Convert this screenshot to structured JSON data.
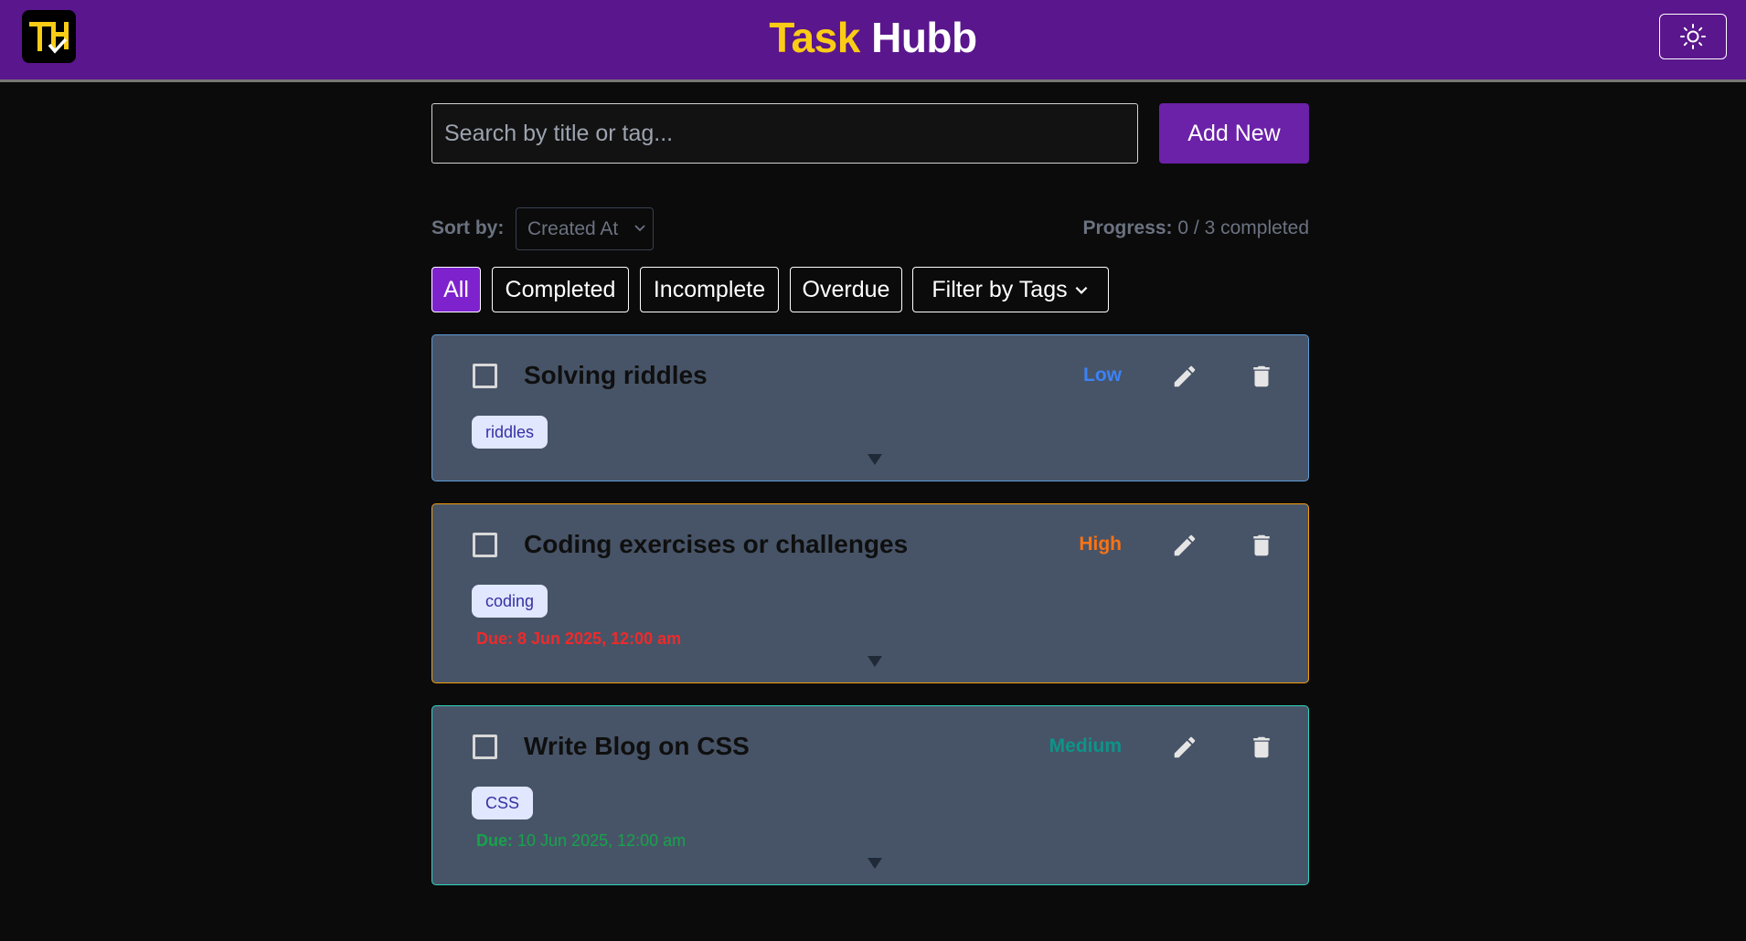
{
  "header": {
    "logo_text": "TH",
    "title_part1": "Task",
    "title_part2": "Hubb",
    "theme_icon": "sun-icon"
  },
  "toolbar": {
    "search_placeholder": "Search by title or tag...",
    "add_label": "Add New"
  },
  "sort": {
    "label": "Sort by:",
    "selected": "Created At"
  },
  "progress": {
    "label": "Progress:",
    "value": "0 / 3 completed"
  },
  "filters": [
    "All",
    "Completed",
    "Incomplete",
    "Overdue",
    "Filter by Tags"
  ],
  "tasks": [
    {
      "title": "Solving riddles",
      "priority": "Low",
      "priority_color": "#3b82f6",
      "tag": "riddles",
      "due_label": "",
      "due_value": "",
      "completed": false
    },
    {
      "title": "Coding exercises or challenges",
      "priority": "High",
      "priority_color": "#f97316",
      "tag": "coding",
      "due_label": "Due:",
      "due_value": "8 Jun 2025, 12:00 am",
      "due_color": "#ef2a2a",
      "completed": false
    },
    {
      "title": "Write Blog on CSS",
      "priority": "Medium",
      "priority_color": "#0d9488",
      "tag": "CSS",
      "due_label": "Due:",
      "due_value": "10 Jun 2025, 12:00 am",
      "due_color": "#16a34a",
      "completed": false
    }
  ],
  "colors": {
    "header_bg": "#5a168c",
    "accent": "#7e22ce",
    "card_bg": "#475467",
    "title_yellow": "#facc15"
  }
}
